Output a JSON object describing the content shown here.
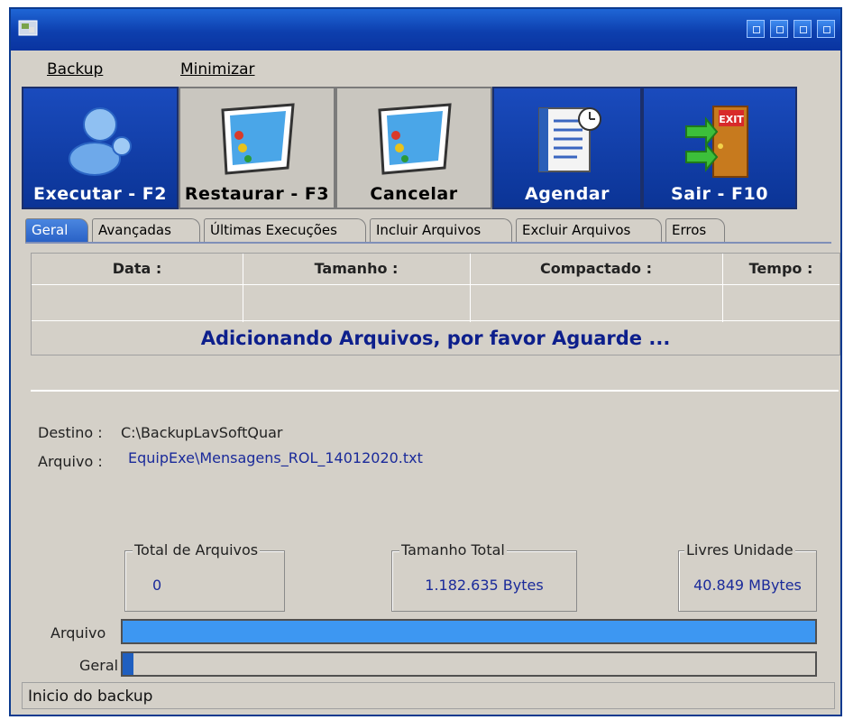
{
  "menu": {
    "backup_label": "Backup",
    "minimizar_label": "Minimizar"
  },
  "toolbar": {
    "executar": "Executar - F2",
    "restaurar": "Restaurar - F3",
    "cancelar": "Cancelar",
    "agendar": "Agendar",
    "sair": "Sair - F10"
  },
  "tabs": [
    "Geral",
    "Avançadas",
    "Últimas Execuções",
    "Incluir Arquivos",
    "Excluir Arquivos",
    "Erros"
  ],
  "grid": {
    "headers": [
      "Data :",
      "Tamanho :",
      "Compactado :",
      "Tempo :"
    ],
    "message": "Adicionando Arquivos, por favor Aguarde ..."
  },
  "details": {
    "destino_label": "Destino :",
    "destino_value": "C:\\BackupLavSoftQuar",
    "arquivo_label": "Arquivo :",
    "arquivo_value": "EquipExe\\Mensagens_ROL_14012020.txt"
  },
  "stats": {
    "total_arquivos_label": "Total de Arquivos",
    "total_arquivos_value": "0",
    "tamanho_total_label": "Tamanho Total",
    "tamanho_total_value": "1.182.635 Bytes",
    "livres_label": "Livres Unidade",
    "livres_value": "40.849 MBytes"
  },
  "progress": {
    "arquivo_label": "Arquivo",
    "arquivo_fraction": 1.0,
    "geral_label": "Geral",
    "geral_fraction": 0.015
  },
  "statusbar": {
    "text": "Inicio do backup"
  },
  "colors": {
    "title_blue": "#0d3fae",
    "toolbar_blue": "#0b3496",
    "message_text": "#0d1f8c",
    "progress_fill": "#3d97f2"
  }
}
